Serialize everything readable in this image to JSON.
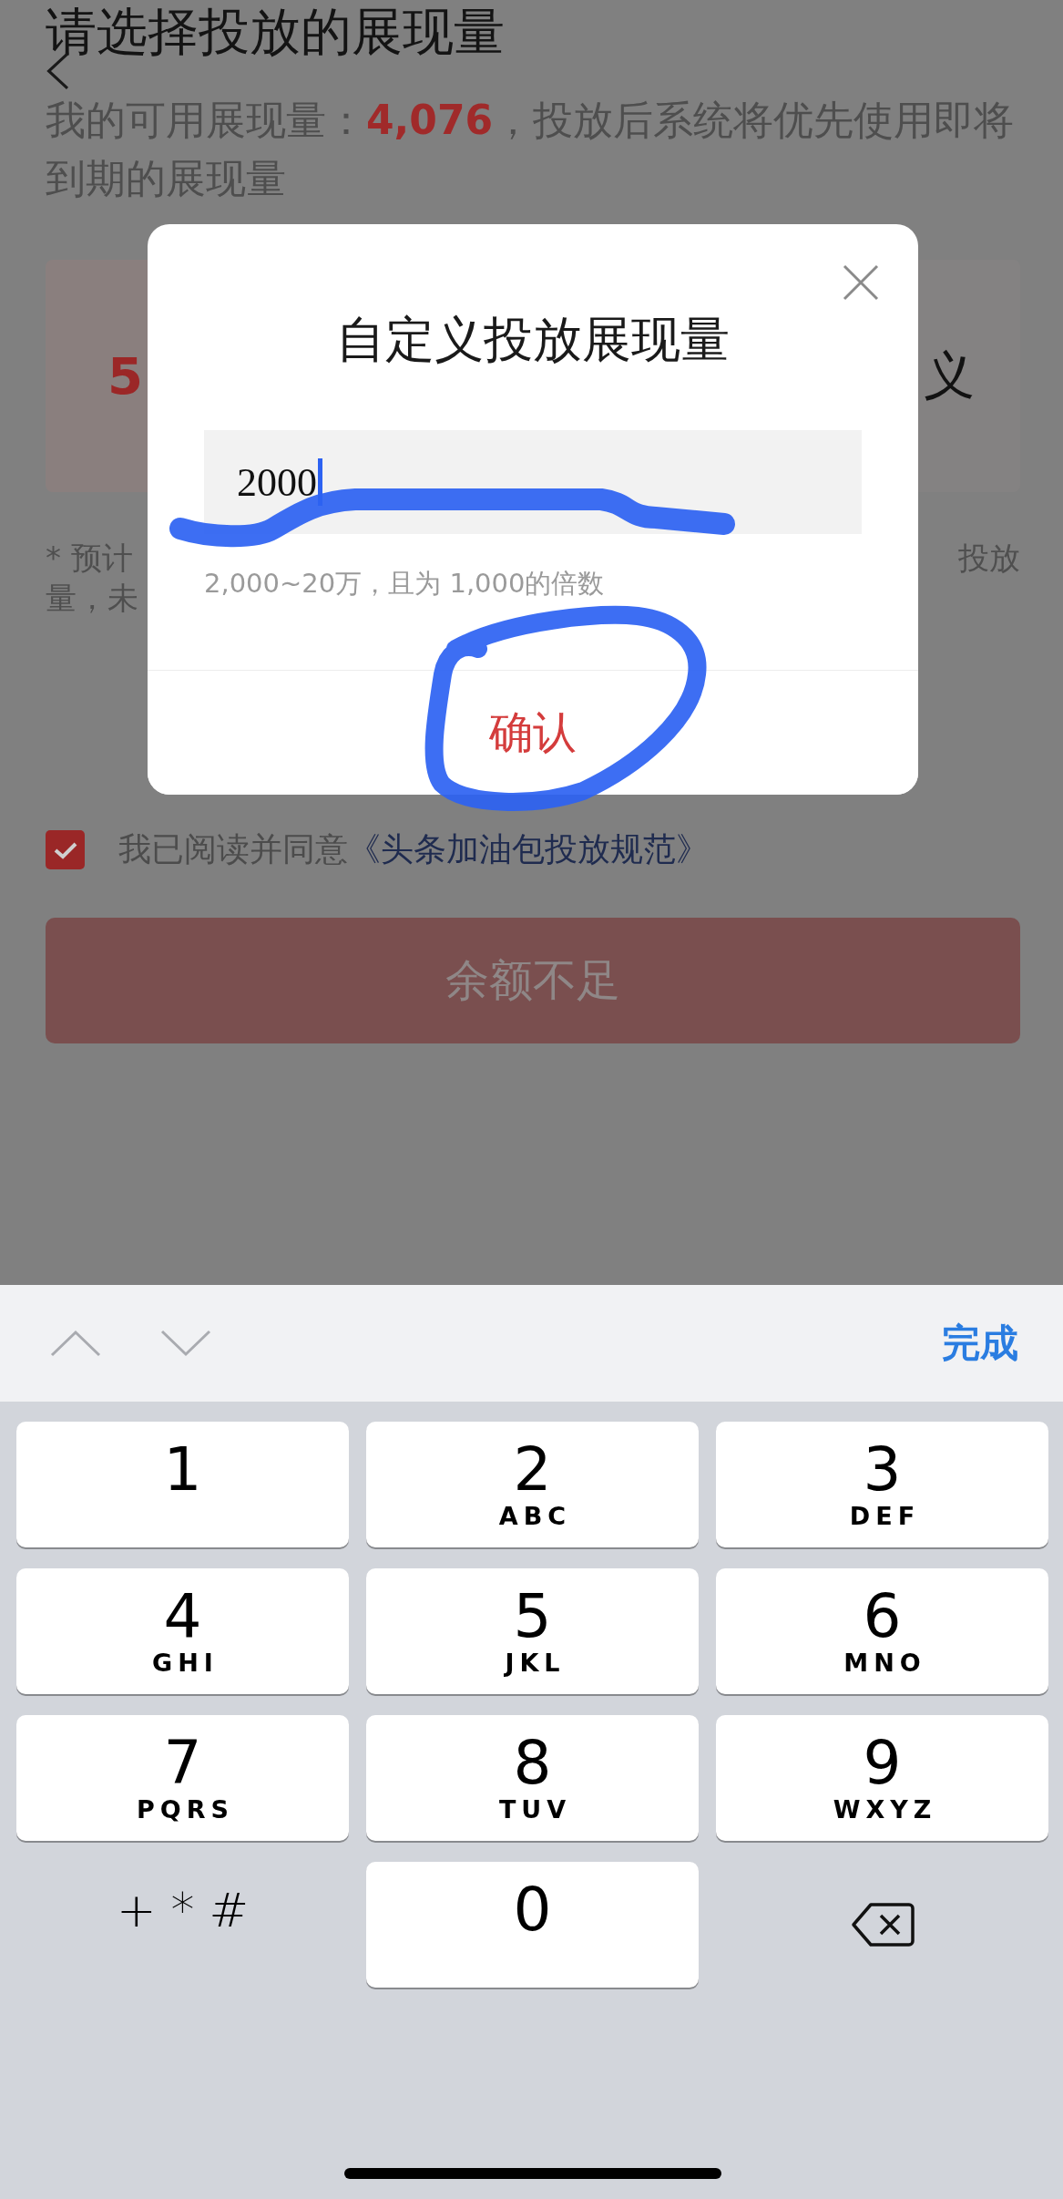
{
  "header": {
    "title": "请选择投放的展现量",
    "subtitle": "我的可用展现量：**4,076**，投放后系统将优先使用即将到期的展现量"
  },
  "cards": [
    {
      "text": "5",
      "kind": "amount"
    },
    {
      "text": "义",
      "kind": "custom"
    }
  ],
  "note": {
    "line_1_left": "* 预计",
    "line_1_right": "投放",
    "line_2": "量，未"
  },
  "agreement": {
    "checked": true,
    "text": "我已阅读并同意",
    "link": "《头条加油包投放规范》"
  },
  "submit_button": {
    "label": "余额不足",
    "disabled": true
  },
  "dialog": {
    "title": "自定义投放展现量",
    "value": "2000",
    "hint": "2,000~20万，且为 1,000的倍数",
    "confirm": "确认"
  },
  "keyboard_toolbar": {
    "done": "完成"
  },
  "keys": [
    {
      "kind": "digit",
      "digit": "1"
    },
    {
      "kind": "digit",
      "digit": "2",
      "letters": "ABC"
    },
    {
      "kind": "digit",
      "digit": "3",
      "letters": "DEF"
    },
    {
      "kind": "digit",
      "digit": "4",
      "letters": "GHI"
    },
    {
      "kind": "digit",
      "digit": "5",
      "letters": "JKL"
    },
    {
      "kind": "digit",
      "digit": "6",
      "letters": "MNO"
    },
    {
      "kind": "digit",
      "digit": "7",
      "letters": "PQRS"
    },
    {
      "kind": "digit",
      "digit": "8",
      "letters": "TUV"
    },
    {
      "kind": "digit",
      "digit": "9",
      "letters": "WXYZ"
    },
    {
      "kind": "symbols",
      "label": "+*#"
    },
    {
      "kind": "digit",
      "digit": "0"
    },
    {
      "kind": "delete"
    }
  ]
}
